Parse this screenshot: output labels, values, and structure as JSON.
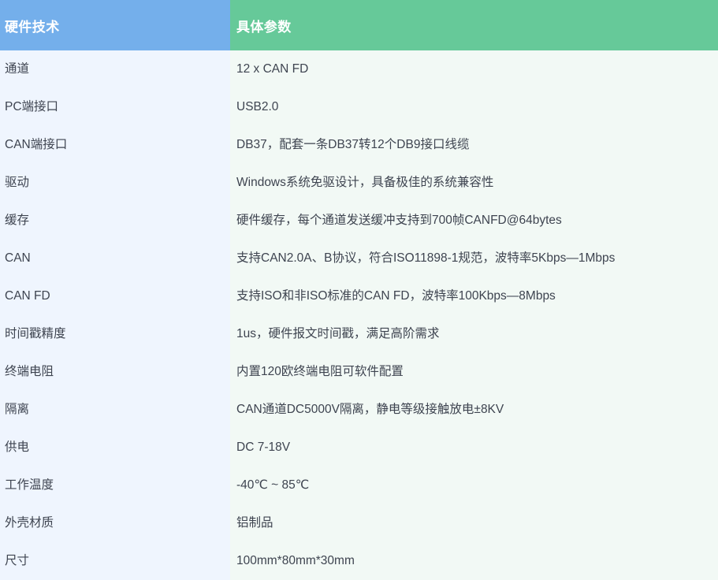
{
  "table": {
    "headers": {
      "feature": "硬件技术",
      "value": "具体参数"
    },
    "colors": {
      "header_feature_bg": "#74afeb",
      "header_value_bg": "#66c999",
      "header_text": "#ffffff",
      "body_feature_bg": "#eff5fe",
      "body_value_bg": "#f2f9f5",
      "body_text": "#3e4450"
    },
    "rows": [
      {
        "feature": "通道",
        "value": "12 x CAN FD"
      },
      {
        "feature": "PC端接口",
        "value": "USB2.0"
      },
      {
        "feature": "CAN端接口",
        "value": "DB37，配套一条DB37转12个DB9接口线缆"
      },
      {
        "feature": "驱动",
        "value": "Windows系统免驱设计，具备极佳的系统兼容性"
      },
      {
        "feature": "缓存",
        "value": "硬件缓存，每个通道发送缓冲支持到700帧CANFD@64bytes"
      },
      {
        "feature": "CAN",
        "value": "支持CAN2.0A、B协议，符合ISO11898-1规范，波特率5Kbps—1Mbps"
      },
      {
        "feature": "CAN FD",
        "value": "支持ISO和非ISO标准的CAN FD，波特率100Kbps—8Mbps"
      },
      {
        "feature": "时间戳精度",
        "value": "1us，硬件报文时间戳，满足高阶需求"
      },
      {
        "feature": "终端电阻",
        "value": "内置120欧终端电阻可软件配置"
      },
      {
        "feature": "隔离",
        "value": "CAN通道DC5000V隔离，静电等级接触放电±8KV"
      },
      {
        "feature": "供电",
        "value": "DC 7-18V"
      },
      {
        "feature": "工作温度",
        "value": "-40℃ ~ 85℃"
      },
      {
        "feature": "外壳材质",
        "value": "铝制品"
      },
      {
        "feature": "尺寸",
        "value": "100mm*80mm*30mm"
      }
    ]
  }
}
